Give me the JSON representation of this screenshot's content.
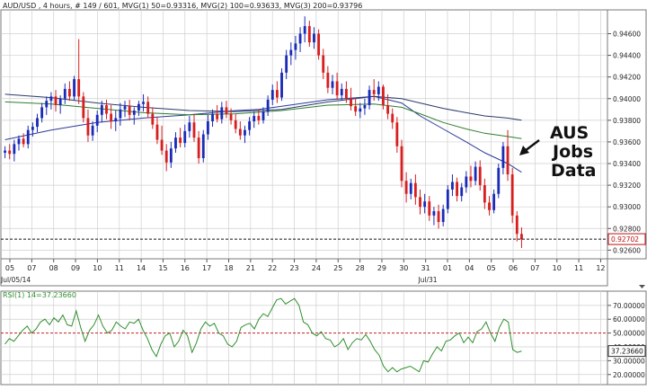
{
  "header_text": "AUD/USD , 4 hours, # 149 / 601, MVG(1) 50=0.93316, MVG(2) 100=0.93633, MVG(3) 200=0.93796",
  "colors": {
    "background": "#ffffff",
    "grid": "#cfcfcf",
    "bull_candle": "#1a2bb8",
    "bear_candle": "#d81e1e",
    "mvg_50": "#2a3a9a",
    "mvg_100": "#2f7d2f",
    "mvg_200": "#2a3a6a",
    "rsi_line": "#2f8f2f",
    "rsi_mid": "#c02020",
    "current_box": "#c01010"
  },
  "annotation": {
    "lines": [
      "AUS",
      "Jobs",
      "Data"
    ]
  },
  "chart_data": [
    {
      "type": "candlestick",
      "title": "AUD/USD , 4 hours",
      "y_tick_labels": [
        "0.94600",
        "0.94400",
        "0.94200",
        "0.94000",
        "0.93800",
        "0.93600",
        "0.93400",
        "0.93200",
        "0.93000",
        "0.92800",
        "0.92600"
      ],
      "ylim": [
        0.9252,
        0.9482
      ],
      "current_value": 0.92702,
      "current_value_label": "0.92702",
      "x_tick_labels": [
        "05",
        "07",
        "08",
        "09",
        "10",
        "11",
        "14",
        "15",
        "16",
        "17",
        "18",
        "21",
        "22",
        "23",
        "24",
        "25",
        "28",
        "29",
        "30",
        "31",
        "01",
        "04",
        "05",
        "06",
        "07",
        "10",
        "11",
        "12"
      ],
      "x_sub_labels": [
        "Jul/05/14",
        "Jul/31"
      ],
      "grid": true,
      "candles_ohlc": [
        [
          0.935,
          0.9356,
          0.9345,
          0.9352
        ],
        [
          0.9352,
          0.9358,
          0.9344,
          0.9349
        ],
        [
          0.9349,
          0.9362,
          0.9342,
          0.9358
        ],
        [
          0.9358,
          0.9366,
          0.9352,
          0.9363
        ],
        [
          0.9363,
          0.9368,
          0.9355,
          0.9358
        ],
        [
          0.9358,
          0.9375,
          0.9354,
          0.9371
        ],
        [
          0.9371,
          0.9378,
          0.9365,
          0.9374
        ],
        [
          0.9374,
          0.9386,
          0.9369,
          0.9382
        ],
        [
          0.9382,
          0.9396,
          0.9378,
          0.9392
        ],
        [
          0.9392,
          0.9402,
          0.9385,
          0.9398
        ],
        [
          0.9398,
          0.9406,
          0.939,
          0.9402
        ],
        [
          0.9402,
          0.9408,
          0.9388,
          0.9394
        ],
        [
          0.9394,
          0.9403,
          0.9386,
          0.94
        ],
        [
          0.94,
          0.9414,
          0.9395,
          0.9409
        ],
        [
          0.9409,
          0.9416,
          0.9398,
          0.9402
        ],
        [
          0.9402,
          0.9421,
          0.9398,
          0.9418
        ],
        [
          0.9418,
          0.9455,
          0.9395,
          0.9402
        ],
        [
          0.9402,
          0.9406,
          0.9378,
          0.9382
        ],
        [
          0.9382,
          0.939,
          0.936,
          0.9366
        ],
        [
          0.9366,
          0.9379,
          0.9361,
          0.9375
        ],
        [
          0.9375,
          0.9389,
          0.9369,
          0.9385
        ],
        [
          0.9385,
          0.9398,
          0.9378,
          0.9394
        ],
        [
          0.9394,
          0.9399,
          0.9381,
          0.9386
        ],
        [
          0.9386,
          0.9394,
          0.9372,
          0.9379
        ],
        [
          0.9379,
          0.9389,
          0.937,
          0.9382
        ],
        [
          0.9382,
          0.9396,
          0.9375,
          0.939
        ],
        [
          0.939,
          0.9398,
          0.9383,
          0.9393
        ],
        [
          0.9393,
          0.9399,
          0.938,
          0.9385
        ],
        [
          0.9385,
          0.9392,
          0.9376,
          0.9389
        ],
        [
          0.9389,
          0.9398,
          0.9384,
          0.9395
        ],
        [
          0.9395,
          0.9404,
          0.9388,
          0.9397
        ],
        [
          0.9397,
          0.9402,
          0.9382,
          0.9386
        ],
        [
          0.9386,
          0.9392,
          0.9372,
          0.9376
        ],
        [
          0.9376,
          0.9383,
          0.9358,
          0.9362
        ],
        [
          0.9362,
          0.9375,
          0.9348,
          0.9352
        ],
        [
          0.9352,
          0.9358,
          0.9333,
          0.9341
        ],
        [
          0.9341,
          0.936,
          0.9336,
          0.9354
        ],
        [
          0.9354,
          0.9369,
          0.935,
          0.9364
        ],
        [
          0.9364,
          0.9373,
          0.9355,
          0.9359
        ],
        [
          0.9359,
          0.9376,
          0.9355,
          0.937
        ],
        [
          0.937,
          0.9384,
          0.9364,
          0.9378
        ],
        [
          0.9378,
          0.9386,
          0.936,
          0.9364
        ],
        [
          0.9364,
          0.937,
          0.934,
          0.9345
        ],
        [
          0.9345,
          0.9371,
          0.9341,
          0.9367
        ],
        [
          0.9367,
          0.9385,
          0.9362,
          0.9379
        ],
        [
          0.9379,
          0.939,
          0.9374,
          0.9386
        ],
        [
          0.9386,
          0.9394,
          0.9378,
          0.9381
        ],
        [
          0.9381,
          0.9397,
          0.9377,
          0.9392
        ],
        [
          0.9392,
          0.9398,
          0.9382,
          0.9386
        ],
        [
          0.9386,
          0.9391,
          0.9376,
          0.938
        ],
        [
          0.938,
          0.9386,
          0.9368,
          0.9372
        ],
        [
          0.9372,
          0.9379,
          0.9362,
          0.9366
        ],
        [
          0.9366,
          0.9375,
          0.9359,
          0.9371
        ],
        [
          0.9371,
          0.9383,
          0.9366,
          0.9379
        ],
        [
          0.9379,
          0.9388,
          0.9373,
          0.9384
        ],
        [
          0.9384,
          0.939,
          0.9376,
          0.938
        ],
        [
          0.938,
          0.9392,
          0.9377,
          0.9388
        ],
        [
          0.9388,
          0.9403,
          0.9384,
          0.9399
        ],
        [
          0.9399,
          0.9413,
          0.9394,
          0.9408
        ],
        [
          0.9408,
          0.9416,
          0.9396,
          0.9401
        ],
        [
          0.9401,
          0.9428,
          0.9398,
          0.9424
        ],
        [
          0.9424,
          0.9445,
          0.9418,
          0.944
        ],
        [
          0.944,
          0.9452,
          0.9431,
          0.9445
        ],
        [
          0.9445,
          0.9458,
          0.9436,
          0.9451
        ],
        [
          0.9451,
          0.9466,
          0.9443,
          0.946
        ],
        [
          0.946,
          0.9476,
          0.9452,
          0.9467
        ],
        [
          0.9467,
          0.9472,
          0.9448,
          0.9452
        ],
        [
          0.9452,
          0.9466,
          0.9446,
          0.946
        ],
        [
          0.946,
          0.9464,
          0.9436,
          0.944
        ],
        [
          0.944,
          0.9446,
          0.9418,
          0.9424
        ],
        [
          0.9424,
          0.943,
          0.9405,
          0.941
        ],
        [
          0.941,
          0.9422,
          0.9404,
          0.9416
        ],
        [
          0.9416,
          0.9424,
          0.9399,
          0.9403
        ],
        [
          0.9403,
          0.9414,
          0.9398,
          0.9409
        ],
        [
          0.9409,
          0.9416,
          0.9396,
          0.94
        ],
        [
          0.94,
          0.941,
          0.9389,
          0.9393
        ],
        [
          0.9393,
          0.9401,
          0.9384,
          0.9388
        ],
        [
          0.9388,
          0.9396,
          0.9382,
          0.9391
        ],
        [
          0.9391,
          0.94,
          0.9385,
          0.9394
        ],
        [
          0.9394,
          0.9412,
          0.939,
          0.9408
        ],
        [
          0.9408,
          0.9418,
          0.9398,
          0.9404
        ],
        [
          0.9404,
          0.9416,
          0.9398,
          0.9411
        ],
        [
          0.9411,
          0.9413,
          0.939,
          0.9394
        ],
        [
          0.9394,
          0.9404,
          0.9381,
          0.9386
        ],
        [
          0.9386,
          0.9391,
          0.9372,
          0.9378
        ],
        [
          0.9378,
          0.9383,
          0.935,
          0.9356
        ],
        [
          0.9356,
          0.9362,
          0.9318,
          0.9324
        ],
        [
          0.9324,
          0.9332,
          0.9304,
          0.9312
        ],
        [
          0.9312,
          0.9326,
          0.9307,
          0.9322
        ],
        [
          0.9322,
          0.933,
          0.9302,
          0.9309
        ],
        [
          0.9309,
          0.9316,
          0.9293,
          0.93
        ],
        [
          0.93,
          0.9312,
          0.9294,
          0.9305
        ],
        [
          0.9305,
          0.931,
          0.9287,
          0.9292
        ],
        [
          0.9292,
          0.93,
          0.9283,
          0.9296
        ],
        [
          0.9296,
          0.9302,
          0.928,
          0.9286
        ],
        [
          0.9286,
          0.9302,
          0.9282,
          0.9298
        ],
        [
          0.9298,
          0.932,
          0.9294,
          0.9316
        ],
        [
          0.9316,
          0.933,
          0.931,
          0.9323
        ],
        [
          0.9323,
          0.9327,
          0.9305,
          0.931
        ],
        [
          0.931,
          0.9322,
          0.9305,
          0.9318
        ],
        [
          0.9318,
          0.9333,
          0.9313,
          0.9328
        ],
        [
          0.9328,
          0.9338,
          0.9318,
          0.9324
        ],
        [
          0.9324,
          0.9342,
          0.932,
          0.9337
        ],
        [
          0.9337,
          0.9343,
          0.9315,
          0.932
        ],
        [
          0.932,
          0.9326,
          0.9298,
          0.9304
        ],
        [
          0.9304,
          0.931,
          0.9292,
          0.9297
        ],
        [
          0.9297,
          0.9316,
          0.9294,
          0.9312
        ],
        [
          0.9312,
          0.934,
          0.9308,
          0.9336
        ],
        [
          0.9336,
          0.936,
          0.933,
          0.9356
        ],
        [
          0.9356,
          0.9371,
          0.9324,
          0.933
        ],
        [
          0.933,
          0.9336,
          0.9285,
          0.9292
        ],
        [
          0.9292,
          0.9296,
          0.9268,
          0.9275
        ],
        [
          0.9275,
          0.9281,
          0.9262,
          0.927
        ]
      ],
      "series": [
        {
          "name": "MVG(1) 50",
          "value_label": "0.93316",
          "x_index": [
            0,
            10,
            20,
            30,
            40,
            50,
            55,
            60,
            70,
            80,
            86,
            90,
            95,
            100,
            104,
            109,
            112
          ],
          "values": [
            0.9362,
            0.9371,
            0.9378,
            0.9382,
            0.9385,
            0.9389,
            0.939,
            0.9393,
            0.9399,
            0.9402,
            0.9396,
            0.9384,
            0.9372,
            0.936,
            0.935,
            0.934,
            0.9332
          ]
        },
        {
          "name": "MVG(2) 100",
          "x_index": [
            0,
            10,
            20,
            30,
            40,
            50,
            60,
            70,
            80,
            86,
            90,
            95,
            100,
            104,
            109,
            112
          ],
          "values": [
            0.9397,
            0.9395,
            0.9391,
            0.9387,
            0.9385,
            0.9386,
            0.9389,
            0.9394,
            0.9395,
            0.9392,
            0.9386,
            0.9378,
            0.9372,
            0.9368,
            0.9365,
            0.9363
          ]
        },
        {
          "name": "MVG(3) 200",
          "x_index": [
            0,
            10,
            20,
            30,
            40,
            50,
            60,
            70,
            80,
            86,
            90,
            95,
            100,
            104,
            109,
            112
          ],
          "values": [
            0.9404,
            0.9401,
            0.9396,
            0.9392,
            0.9389,
            0.9388,
            0.939,
            0.9397,
            0.9402,
            0.94,
            0.9396,
            0.9391,
            0.9387,
            0.9384,
            0.9382,
            0.938
          ]
        }
      ]
    },
    {
      "type": "line",
      "title": "RSI(1) 14=37.23660",
      "y_tick_labels": [
        "70.00000",
        "60.00000",
        "50.00000",
        "40.00000",
        "30.00000",
        "20.00000"
      ],
      "ylim": [
        14,
        79
      ],
      "current_value_label": "37.23660",
      "midline": 50,
      "series": [
        {
          "name": "RSI(1) 14",
          "values": [
            42,
            46,
            44,
            48,
            52,
            55,
            50,
            53,
            58,
            60,
            56,
            61,
            58,
            63,
            56,
            55,
            66,
            54,
            44,
            52,
            56,
            63,
            55,
            50,
            52,
            58,
            55,
            53,
            58,
            57,
            60,
            52,
            46,
            38,
            33,
            42,
            48,
            50,
            40,
            44,
            52,
            48,
            36,
            43,
            53,
            58,
            55,
            57,
            50,
            48,
            42,
            40,
            44,
            54,
            56,
            57,
            53,
            60,
            64,
            62,
            68,
            74,
            75,
            71,
            73,
            75,
            70,
            58,
            56,
            50,
            48,
            51,
            46,
            45,
            40,
            42,
            46,
            38,
            43,
            46,
            45,
            49,
            44,
            38,
            34,
            26,
            22,
            25,
            22,
            24,
            25,
            26,
            24,
            22,
            30,
            29,
            35,
            40,
            37,
            44,
            45,
            48,
            50,
            43,
            47,
            43,
            51,
            53,
            58,
            50,
            44,
            54,
            60,
            58,
            38,
            36,
            37
          ]
        }
      ]
    }
  ]
}
